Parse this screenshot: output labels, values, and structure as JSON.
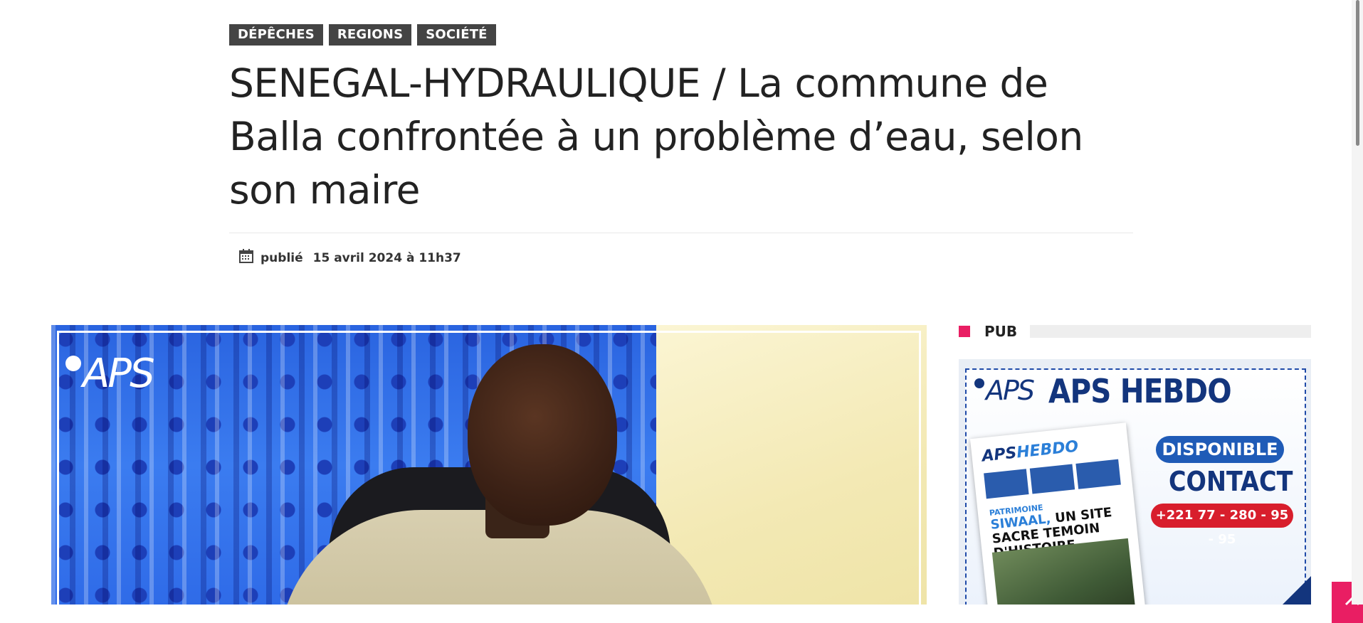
{
  "categories": [
    "DÉPÊCHES",
    "REGIONS",
    "SOCIÉTÉ"
  ],
  "article": {
    "title": "SENEGAL-HYDRAULIQUE / La commune de Balla confrontée à un problème d’eau, selon son maire",
    "published_label": "publié",
    "published_date": "15 avril 2024 à 11h37"
  },
  "photo": {
    "watermark": "APS"
  },
  "sidebar": {
    "section_label": "PUB",
    "ad": {
      "logo": "APS",
      "title": "APS HEBDO",
      "magazine_logo_a": "APS",
      "magazine_logo_b": "HEBDO",
      "magazine_kicker": "PATRIMOINE",
      "magazine_headline_a": "SIWAAL,",
      "magazine_headline_b": "UN SITE SACRE TEMOIN D'HISTOIRE",
      "available": "DISPONIBLE",
      "contact": "CONTACT",
      "phone": "+221 77 - 280 - 95 - 95"
    }
  },
  "controls": {
    "scroll_top_icon": "chevron-up-icon",
    "accent_color": "#e91e63"
  }
}
